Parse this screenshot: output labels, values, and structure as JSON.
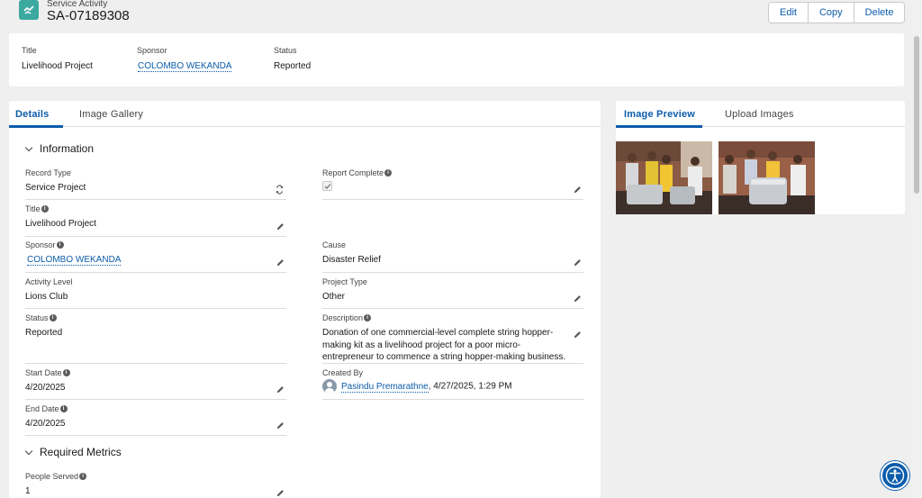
{
  "header": {
    "object_type": "Service Activity",
    "record_name": "SA-07189308",
    "actions": [
      "Edit",
      "Copy",
      "Delete"
    ]
  },
  "highlights": {
    "fields": [
      {
        "label": "Title",
        "value": "Livelihood Project"
      },
      {
        "label": "Sponsor",
        "value": "COLOMBO WEKANDA"
      },
      {
        "label": "Status",
        "value": "Reported"
      }
    ]
  },
  "detail_tabs": [
    "Details",
    "Image Gallery"
  ],
  "sections": {
    "information": "Information",
    "required_metrics": "Required Metrics"
  },
  "fields": {
    "record_type": {
      "label": "Record Type",
      "value": "Service Project"
    },
    "title": {
      "label": "Title",
      "value": "Livelihood Project"
    },
    "sponsor": {
      "label": "Sponsor",
      "value": "COLOMBO WEKANDA"
    },
    "activity_level": {
      "label": "Activity Level",
      "value": "Lions Club"
    },
    "status": {
      "label": "Status",
      "value": "Reported"
    },
    "start_date": {
      "label": "Start Date",
      "value": "4/20/2025"
    },
    "end_date": {
      "label": "End Date",
      "value": "4/20/2025"
    },
    "report_complete": {
      "label": "Report Complete",
      "checked": true
    },
    "cause": {
      "label": "Cause",
      "value": "Disaster Relief"
    },
    "project_type": {
      "label": "Project Type",
      "value": "Other"
    },
    "description": {
      "label": "Description",
      "value": "Donation of one commercial-level complete string hopper-making kit as a livelihood project for a poor micro-entrepreneur to commence a string hopper-making business."
    },
    "created_by": {
      "label": "Created By",
      "user": "Pasindu Premarathne",
      "date": ", 4/27/2025, 1:29 PM"
    },
    "people_served": {
      "label": "People Served",
      "value": "1"
    }
  },
  "gallery_tabs": [
    "Image Preview",
    "Upload Images"
  ],
  "colors": {
    "brand": "#0b5cab",
    "object_icon": "#3ba9a0",
    "background": "#efefef"
  },
  "icons": [
    "service-activity-icon",
    "pencil-icon",
    "info-icon",
    "change-record-type-icon",
    "checkbox-icon",
    "avatar-icon",
    "accessibility-icon"
  ]
}
